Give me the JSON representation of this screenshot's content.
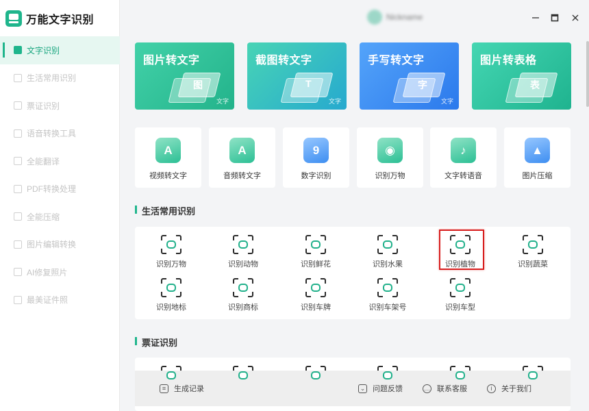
{
  "app": {
    "title": "万能文字识别",
    "user_name": "Nickname"
  },
  "window_controls": [
    "minimize",
    "maximize",
    "close"
  ],
  "sidebar": {
    "items": [
      {
        "label": "文字识别",
        "active": true
      },
      {
        "label": "生活常用识别",
        "active": false
      },
      {
        "label": "票证识别",
        "active": false
      },
      {
        "label": "语音转换工具",
        "active": false
      },
      {
        "label": "全能翻译",
        "active": false
      },
      {
        "label": "PDF转换处理",
        "active": false
      },
      {
        "label": "全能压缩",
        "active": false
      },
      {
        "label": "图片编辑转换",
        "active": false
      },
      {
        "label": "AI修复照片",
        "active": false
      },
      {
        "label": "最美证件照",
        "active": false
      }
    ]
  },
  "banners": [
    {
      "title": "图片转文字",
      "tag": "文字",
      "glyph": "图",
      "colors": [
        "#3ccba2",
        "#2eb68e"
      ]
    },
    {
      "title": "截图转文字",
      "tag": "文字",
      "glyph": "T",
      "colors": [
        "#46d0b6",
        "#2aaecd"
      ]
    },
    {
      "title": "手写转文字",
      "tag": "文字",
      "glyph": "字",
      "colors": [
        "#4d9cf7",
        "#2d7ded"
      ]
    },
    {
      "title": "图片转表格",
      "tag": "",
      "glyph": "表",
      "colors": [
        "#3fd2ae",
        "#22ba94"
      ]
    }
  ],
  "tools": [
    {
      "label": "视频转文字",
      "icon": "video-to-text-icon",
      "glyph": "A",
      "color": "green"
    },
    {
      "label": "音频转文字",
      "icon": "audio-to-text-icon",
      "glyph": "A",
      "color": "green"
    },
    {
      "label": "数字识别",
      "icon": "number-recognition-icon",
      "glyph": "9",
      "color": "blue"
    },
    {
      "label": "识别万物",
      "icon": "eye-icon",
      "glyph": "◉",
      "color": "green"
    },
    {
      "label": "文字转语音",
      "icon": "text-to-speech-icon",
      "glyph": "♪",
      "color": "green"
    },
    {
      "label": "图片压缩",
      "icon": "image-compress-icon",
      "glyph": "▲",
      "color": "blue"
    }
  ],
  "sections": {
    "life": {
      "title": "生活常用识别",
      "items": [
        {
          "label": "识别万物",
          "icon": "eye-scan-icon"
        },
        {
          "label": "识别动物",
          "icon": "animal-scan-icon"
        },
        {
          "label": "识别鲜花",
          "icon": "flower-scan-icon"
        },
        {
          "label": "识别水果",
          "icon": "fruit-scan-icon"
        },
        {
          "label": "识别植物",
          "icon": "plant-scan-icon"
        },
        {
          "label": "识别蔬菜",
          "icon": "vegetable-scan-icon"
        },
        {
          "label": "识别地标",
          "icon": "landmark-scan-icon"
        },
        {
          "label": "识别商标",
          "icon": "trademark-scan-icon"
        },
        {
          "label": "识别车牌",
          "icon": "car-plate-scan-icon"
        },
        {
          "label": "识别车架号",
          "icon": "vin-scan-icon"
        },
        {
          "label": "识别车型",
          "icon": "car-model-scan-icon"
        }
      ]
    },
    "ticket": {
      "title": "票证识别"
    }
  },
  "highlighted_item": "识别植物",
  "footer": {
    "history": "生成记录",
    "feedback": "问题反馈",
    "support": "联系客服",
    "about": "关于我们"
  }
}
